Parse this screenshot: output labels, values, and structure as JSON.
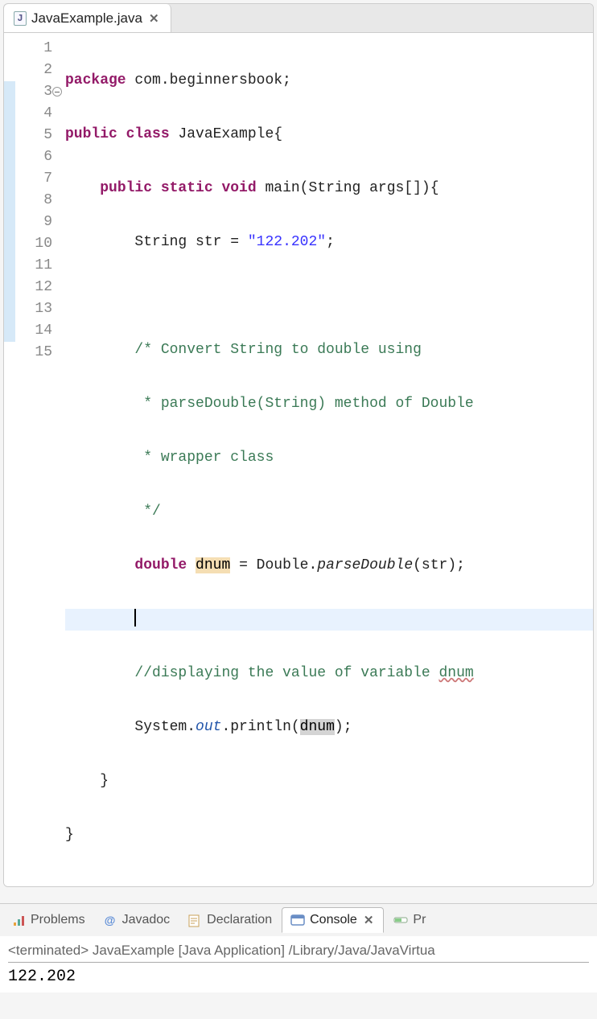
{
  "editor": {
    "tab_label": "JavaExample.java",
    "lines": {
      "1": {
        "n": "1"
      },
      "2": {
        "n": "2"
      },
      "3": {
        "n": "3"
      },
      "4": {
        "n": "4"
      },
      "5": {
        "n": "5"
      },
      "6": {
        "n": "6"
      },
      "7": {
        "n": "7"
      },
      "8": {
        "n": "8"
      },
      "9": {
        "n": "9"
      },
      "10": {
        "n": "10"
      },
      "11": {
        "n": "11"
      },
      "12": {
        "n": "12"
      },
      "13": {
        "n": "13"
      },
      "14": {
        "n": "14"
      },
      "15": {
        "n": "15"
      }
    },
    "tokens": {
      "package_kw": "package",
      "pkg_name": " com.beginnersbook;",
      "public_kw": "public",
      "class_kw": " class",
      "class_name": " JavaExample{",
      "static_kw": " static",
      "void_kw": " void",
      "main_sig": " main(String args[]){",
      "string_type": "String str = ",
      "string_lit": "\"122.202\"",
      "semi": ";",
      "c1": "/* Convert String to double using",
      "c2": " * parseDouble(String) method of Double",
      "c3": " * wrapper class",
      "c4": " */",
      "double_kw": "double",
      "sp": " ",
      "dnum_decl": "dnum",
      "eq_double": " = Double.",
      "parse_call": "parseDouble",
      "call_arg": "(str);",
      "comment_line": "//displaying the value of variable ",
      "dnum_err": "dnum",
      "print1": "System.",
      "out_field": "out",
      "print2": ".println(",
      "dnum_use": "dnum",
      "print3": ");",
      "brace": "}",
      "brace2": "}"
    }
  },
  "bottom": {
    "tabs": {
      "problems": "Problems",
      "javadoc": "Javadoc",
      "declaration": "Declaration",
      "console": "Console",
      "progress": "Pr"
    },
    "console_header": "<terminated> JavaExample [Java Application] /Library/Java/JavaVirtua",
    "console_output": "122.202"
  }
}
